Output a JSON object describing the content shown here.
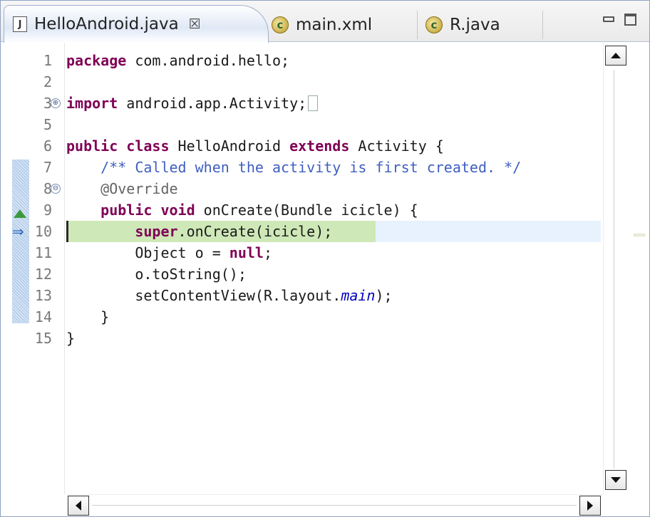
{
  "tabs": [
    {
      "label": "HelloAndroid.java",
      "icon": "java-file-icon",
      "glyph": "J",
      "close": "☒",
      "active": true
    },
    {
      "label": "main.xml",
      "icon": "class-icon",
      "glyph": "c",
      "active": false
    },
    {
      "label": "R.java",
      "icon": "class-icon",
      "glyph": "c",
      "active": false
    }
  ],
  "line_numbers": [
    "1",
    "2",
    "3",
    "5",
    "6",
    "7",
    "8",
    "9",
    "10",
    "11",
    "12",
    "13",
    "14",
    "15"
  ],
  "code": {
    "l1_kw": "package",
    "l1_rest": " com.android.hello;",
    "l3_kw": "import",
    "l3_rest": " android.app.Activity;",
    "l6_kw1": "public class",
    "l6_mid": " HelloAndroid ",
    "l6_kw2": "extends",
    "l6_rest": " Activity {",
    "l7_comment": "    /** Called when the activity is first created. */",
    "l8_annotation": "    @Override",
    "l9_kw": "    public void",
    "l9_rest": " onCreate(Bundle icicle) {",
    "l10_kw": "        super",
    "l10_rest": ".onCreate(icicle);",
    "l11_pre": "        Object o = ",
    "l11_kw": "null",
    "l11_post": ";",
    "l12": "        o.toString();",
    "l13_pre": "        setContentView(R.layout.",
    "l13_field": "main",
    "l13_post": ");",
    "l14": "    }",
    "l15": "}"
  },
  "folds": {
    "expand": "⊕",
    "collapse": "⊖"
  },
  "markers": {
    "instruction_pointer": "⇒"
  },
  "colors": {
    "keyword": "#7f0055",
    "comment": "#3f5fbf",
    "annotation": "#646464",
    "static_field": "#0000c0",
    "current_line": "#e8f2fe",
    "current_statement": "#cfe8b8"
  }
}
